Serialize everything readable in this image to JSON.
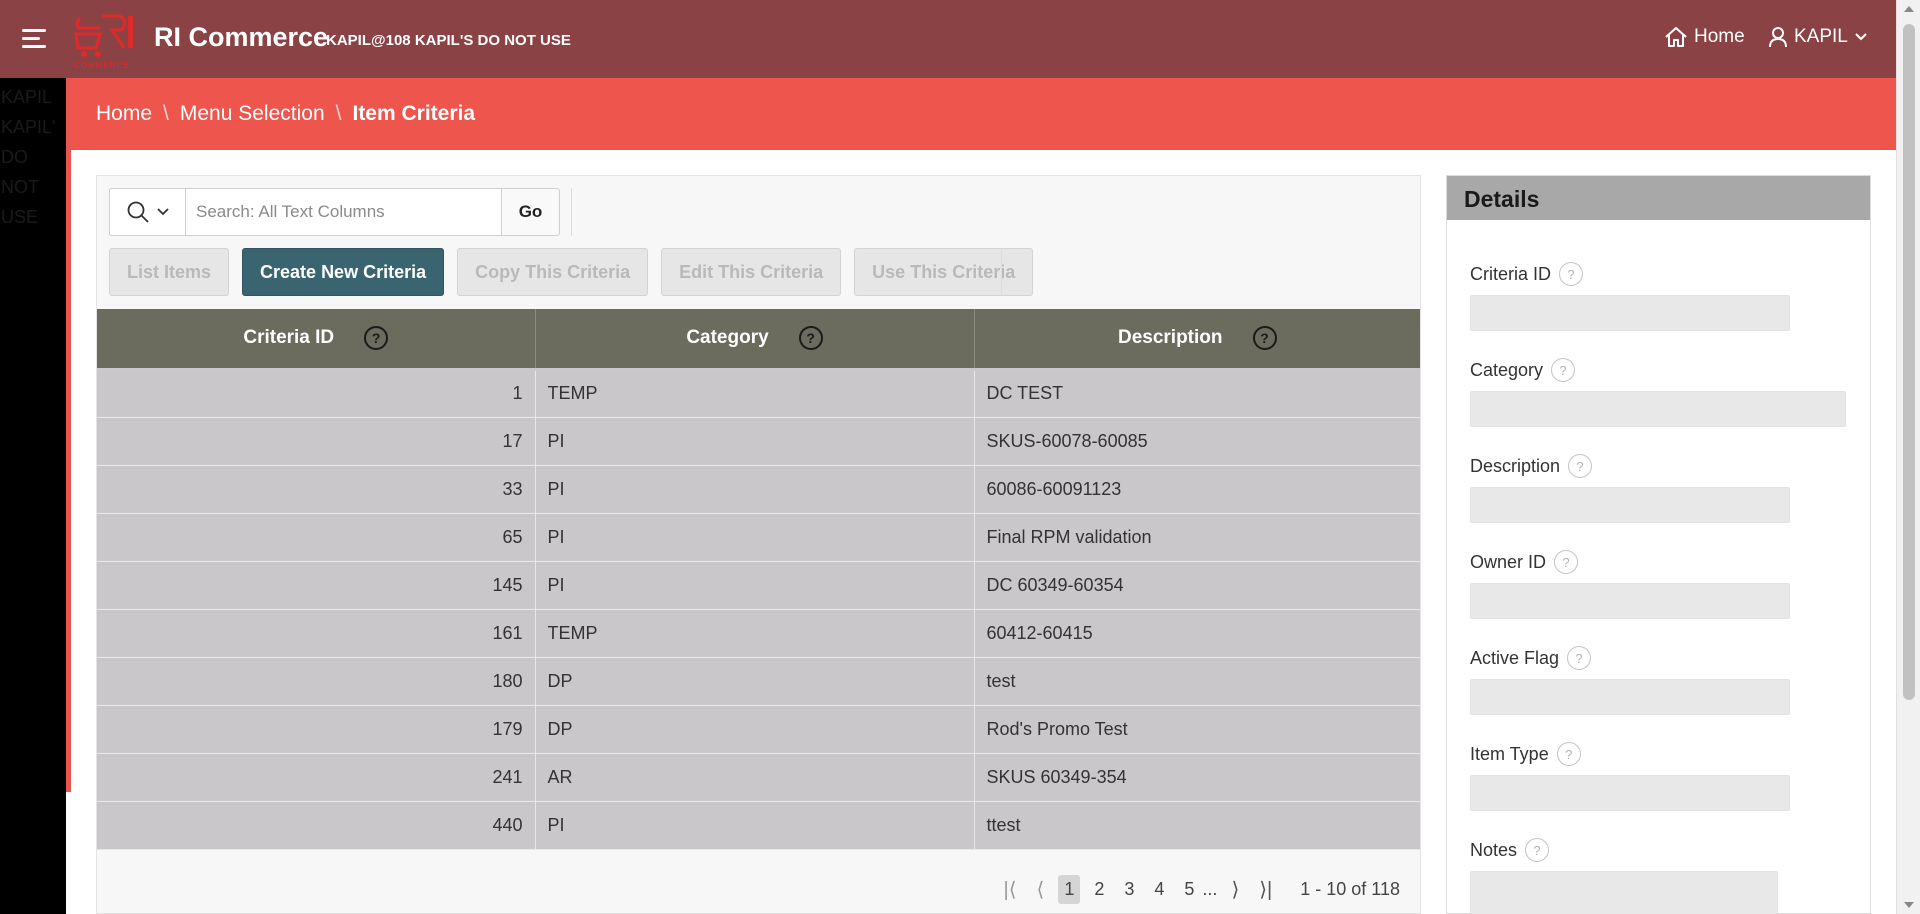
{
  "header": {
    "app_title": "RI Commerce",
    "user_context": "KAPIL@108 KAPIL'S DO NOT USE",
    "home_label": "Home",
    "user_label": "KAPIL",
    "logo_text": "COMMERCE",
    "icons": [
      "hamburger-icon",
      "home-icon",
      "user-icon",
      "chevron-down-icon"
    ]
  },
  "left_strip_text": [
    "KAPIL",
    "KAPIL'",
    "DO",
    "NOT",
    "USE"
  ],
  "breadcrumb": {
    "home": "Home",
    "menu": "Menu Selection",
    "current": "Item Criteria",
    "separator": "\\"
  },
  "search": {
    "placeholder": "Search: All Text Columns",
    "value": "",
    "go_label": "Go"
  },
  "toolbar": {
    "list_items": "List Items",
    "create_new": "Create New Criteria",
    "copy": "Copy This Criteria",
    "edit": "Edit This Criteria",
    "use": "Use This Criteria"
  },
  "table": {
    "columns": [
      "Criteria ID",
      "Category",
      "Description"
    ],
    "help_glyph": "?",
    "rows": [
      {
        "id": "1",
        "category": "TEMP",
        "description": "DC TEST"
      },
      {
        "id": "17",
        "category": "PI",
        "description": "SKUS-60078-60085"
      },
      {
        "id": "33",
        "category": "PI",
        "description": "60086-60091123"
      },
      {
        "id": "65",
        "category": "PI",
        "description": "Final RPM validation"
      },
      {
        "id": "145",
        "category": "PI",
        "description": "DC 60349-60354"
      },
      {
        "id": "161",
        "category": "TEMP",
        "description": "60412-60415"
      },
      {
        "id": "180",
        "category": "DP",
        "description": "test"
      },
      {
        "id": "179",
        "category": "DP",
        "description": "Rod's Promo Test"
      },
      {
        "id": "241",
        "category": "AR",
        "description": "SKUS 60349-354"
      },
      {
        "id": "440",
        "category": "PI",
        "description": "ttest"
      }
    ]
  },
  "pagination": {
    "pages": [
      "1",
      "2",
      "3",
      "4",
      "5"
    ],
    "current": "1",
    "ellipsis": "...",
    "status": "1 - 10 of 118"
  },
  "details": {
    "title": "Details",
    "fields": [
      {
        "label": "Criteria ID",
        "value": ""
      },
      {
        "label": "Category",
        "value": ""
      },
      {
        "label": "Description",
        "value": ""
      },
      {
        "label": "Owner ID",
        "value": ""
      },
      {
        "label": "Active Flag",
        "value": ""
      },
      {
        "label": "Item Type",
        "value": ""
      },
      {
        "label": "Notes",
        "value": ""
      }
    ]
  },
  "colors": {
    "header_bg": "#8b4244",
    "breadcrumb_bg": "#ee554d",
    "primary_button": "#3a6570",
    "table_header": "#6b6b5e",
    "row_bg": "#c9c7c9",
    "details_header": "#a8a8a8"
  }
}
